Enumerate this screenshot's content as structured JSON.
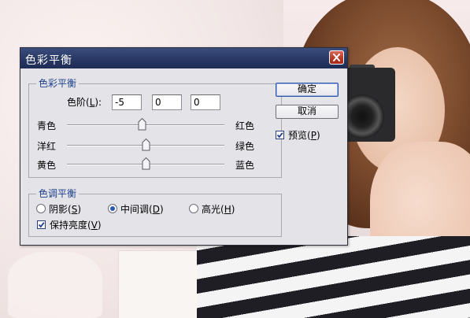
{
  "dialog": {
    "title": "色彩平衡",
    "close_icon": "close-icon"
  },
  "color_balance": {
    "legend": "色彩平衡",
    "levels": {
      "label_prefix": "色阶(",
      "label_key": "L",
      "label_suffix": "):",
      "values": [
        "-5",
        "0",
        "0"
      ]
    },
    "sliders": [
      {
        "left": "青色",
        "right": "红色",
        "value": -5
      },
      {
        "left": "洋红",
        "right": "绿色",
        "value": 0
      },
      {
        "left": "黄色",
        "right": "蓝色",
        "value": 0
      }
    ],
    "slider_range": [
      -100,
      100
    ]
  },
  "tone_balance": {
    "legend": "色调平衡",
    "options": [
      {
        "label": "阴影(",
        "key": "S",
        "suffix": ")",
        "selected": false
      },
      {
        "label": "中间调(",
        "key": "D",
        "suffix": ")",
        "selected": true
      },
      {
        "label": "高光(",
        "key": "H",
        "suffix": ")",
        "selected": false
      }
    ],
    "preserve": {
      "label": "保持亮度(",
      "key": "V",
      "suffix": ")",
      "checked": true
    }
  },
  "buttons": {
    "ok": "确定",
    "cancel": "取消"
  },
  "preview": {
    "label": "预览(",
    "key": "P",
    "suffix": ")",
    "checked": true
  },
  "colors": {
    "titlebar": "#2a3a66",
    "dialog_bg": "#e4e3e8",
    "legend_text": "#1b3f8a",
    "close_button": "#b63724",
    "check_mark": "#1f3d8f"
  }
}
